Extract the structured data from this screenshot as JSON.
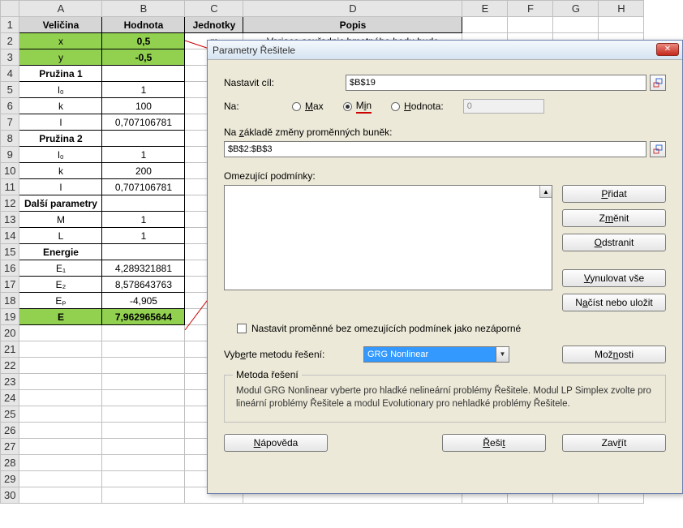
{
  "columns": [
    "A",
    "B",
    "C",
    "D",
    "E",
    "F",
    "G",
    "H"
  ],
  "rows": [
    {
      "n": 1,
      "a": "Veličina",
      "b": "Hodnota",
      "c": "Jednotky",
      "d": "Popis",
      "style": "header"
    },
    {
      "n": 2,
      "a": "x",
      "b": "0,5",
      "c": "m",
      "d": "Variace souřadnic hmotného bodu bude",
      "style": "green"
    },
    {
      "n": 3,
      "a": "y",
      "b": "-0,5",
      "style": "green"
    },
    {
      "n": 4,
      "a": "Pružina 1",
      "style": "section"
    },
    {
      "n": 5,
      "a": "l₀",
      "b": "1"
    },
    {
      "n": 6,
      "a": "k",
      "b": "100"
    },
    {
      "n": 7,
      "a": "l",
      "b": "0,707106781"
    },
    {
      "n": 8,
      "a": "Pružina 2",
      "style": "section"
    },
    {
      "n": 9,
      "a": "l₀",
      "b": "1"
    },
    {
      "n": 10,
      "a": "k",
      "b": "200"
    },
    {
      "n": 11,
      "a": "l",
      "b": "0,707106781"
    },
    {
      "n": 12,
      "a": "Další parametry",
      "style": "section"
    },
    {
      "n": 13,
      "a": "M",
      "b": "1"
    },
    {
      "n": 14,
      "a": "L",
      "b": "1"
    },
    {
      "n": 15,
      "a": "Energie",
      "style": "section"
    },
    {
      "n": 16,
      "a": "E₁",
      "b": "4,289321881"
    },
    {
      "n": 17,
      "a": "E₂",
      "b": "8,578643763"
    },
    {
      "n": 18,
      "a": "Eₚ",
      "b": "-4,905"
    },
    {
      "n": 19,
      "a": "E",
      "b": "7,962965644",
      "style": "greenbold"
    }
  ],
  "blankRows": [
    20,
    21,
    22,
    23,
    24,
    25,
    26,
    27,
    28,
    29,
    30
  ],
  "dialog": {
    "title": "Parametry Řešitele",
    "closeX": "✕",
    "setObjective": "Nastavit cíl:",
    "objectiveVal": "$B$19",
    "na": "Na:",
    "max": "Max",
    "min": "Min",
    "valueOf": "Hodnota:",
    "valueOfVal": "0",
    "byChanging": "Na základě změny proměnných buněk:",
    "variablesVal": "$B$2:$B$3",
    "subjectTo": "Omezující podmínky:",
    "add": "Přidat",
    "change": "Změnit",
    "delete": "Odstranit",
    "resetAll": "Vynulovat vše",
    "loadSave": "Načíst nebo uložit",
    "nonneg": "Nastavit proměnné bez omezujících podmínek jako nezáporné",
    "selectMethod": "Vyberte metodu řešení:",
    "methodVal": "GRG Nonlinear",
    "options": "Možnosti",
    "groupTitle": "Metoda řešení",
    "groupText": "Modul GRG Nonlinear vyberte pro hladké nelineární problémy Řešitele. Modul LP Simplex zvolte pro lineární problémy Řešitele a modul Evolutionary pro nehladké problémy Řešitele.",
    "help": "Nápověda",
    "solve": "Řešit",
    "close": "Zavřít"
  }
}
